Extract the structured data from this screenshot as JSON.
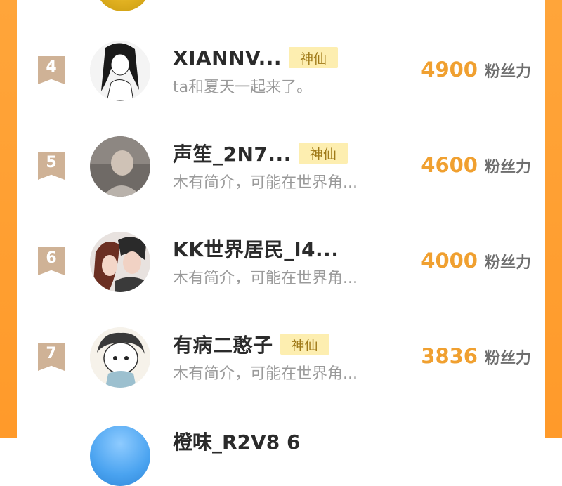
{
  "rows": [
    {
      "rank": "4",
      "name": "XIANNV...",
      "badge": "神仙",
      "bio": "ta和夏天一起来了。",
      "fans_count": "4900",
      "fans_label": "粉丝力"
    },
    {
      "rank": "5",
      "name": "声笙_2N7...",
      "badge": "神仙",
      "bio": "木有简介，可能在世界角...",
      "fans_count": "4600",
      "fans_label": "粉丝力"
    },
    {
      "rank": "6",
      "name": "KK世界居民_l4...",
      "badge": "",
      "bio": "木有简介，可能在世界角...",
      "fans_count": "4000",
      "fans_label": "粉丝力"
    },
    {
      "rank": "7",
      "name": "有病二憨子",
      "badge": "神仙",
      "bio": "木有简介，可能在世界角...",
      "fans_count": "3836",
      "fans_label": "粉丝力"
    }
  ],
  "partial_row": {
    "name": "橙味_R2V8 6"
  },
  "colors": {
    "frame": "#ffa53a",
    "rank_badge": "#cfb296",
    "fans_number": "#f0a030",
    "title_badge_bg": "#fdeeb0"
  }
}
